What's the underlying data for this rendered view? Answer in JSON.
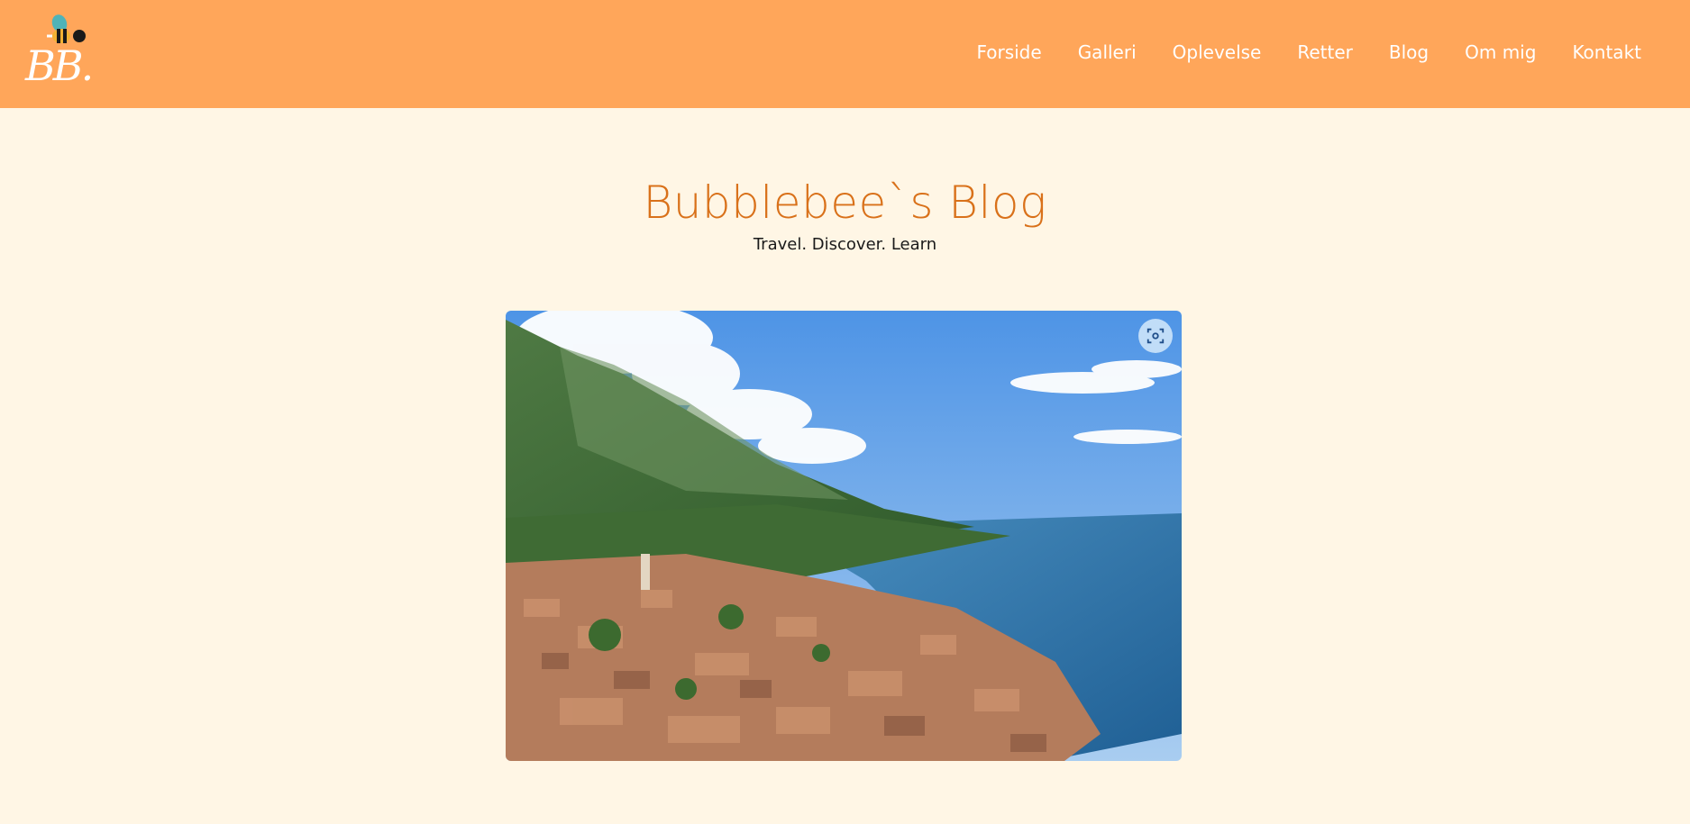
{
  "logo": {
    "text": "BB."
  },
  "nav": {
    "items": [
      {
        "label": "Forside"
      },
      {
        "label": "Galleri"
      },
      {
        "label": "Oplevelse"
      },
      {
        "label": "Retter"
      },
      {
        "label": "Blog"
      },
      {
        "label": "Om mig"
      },
      {
        "label": "Kontakt"
      }
    ]
  },
  "hero": {
    "title": "Bubblebee`s Blog",
    "subtitle": "Travel. Discover. Learn"
  },
  "colors": {
    "header_bg": "#ffa65a",
    "page_bg": "#fff6e5",
    "title": "#d9711a"
  },
  "icons": {
    "image_search": "lens-icon"
  }
}
